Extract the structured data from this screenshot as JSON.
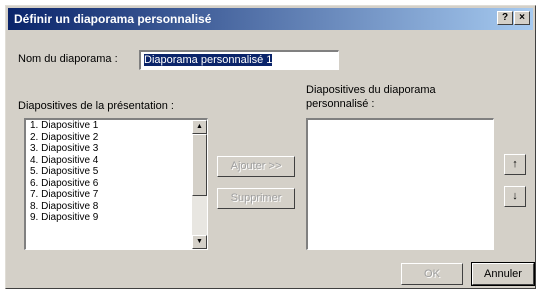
{
  "window": {
    "title": "Définir un diaporama personnalisé",
    "help_label": "?",
    "close_label": "×"
  },
  "name_field": {
    "label": "Nom du diaporama :",
    "value": "Diaporama personnalisé 1"
  },
  "left_list": {
    "label": "Diapositives de la présentation :",
    "items": [
      "1. Diapositive 1",
      "2. Diapositive 2",
      "3. Diapositive 3",
      "4. Diapositive 4",
      "5. Diapositive 5",
      "6. Diapositive 6",
      "7. Diapositive 7",
      "8. Diapositive 8",
      "9. Diapositive 9"
    ]
  },
  "right_list": {
    "label_line1": "Diapositives du diaporama",
    "label_line2": "personnalisé :"
  },
  "buttons": {
    "add": "Ajouter >>",
    "remove": "Supprimer",
    "move_up": "↑",
    "move_down": "↓",
    "ok": "OK",
    "cancel": "Annuler"
  }
}
